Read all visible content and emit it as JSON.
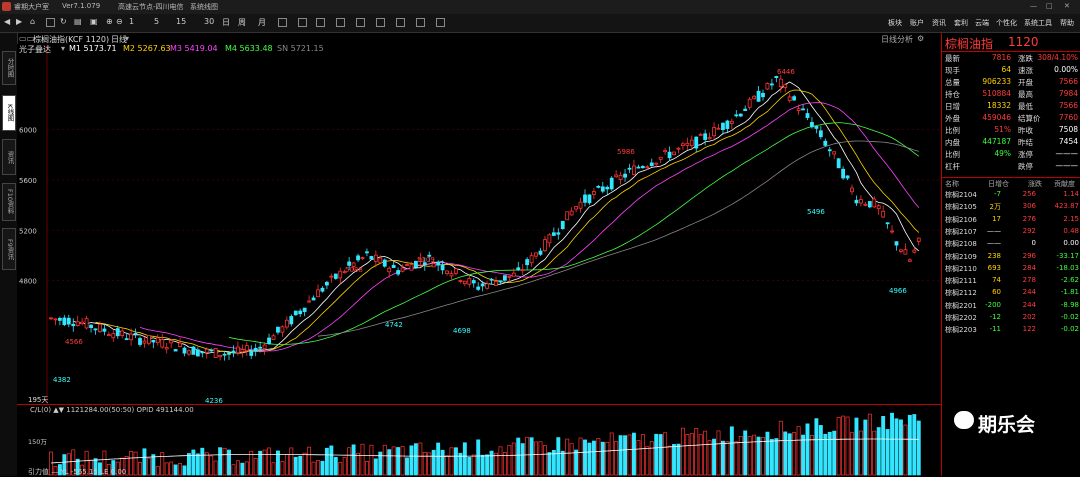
{
  "app": {
    "name": "睿期大户室",
    "version": "Ver7.1.079",
    "server": "高速云节点-四川电信",
    "window_label": "系统线图"
  },
  "toolbar": {
    "periods": [
      "1",
      "5",
      "15",
      "30",
      "日",
      "周",
      "月"
    ],
    "menus": [
      "板块",
      "账户",
      "资讯",
      "套利",
      "云端",
      "个性化",
      "系统工具",
      "帮助"
    ]
  },
  "left_tabs": [
    "分时图",
    "K线图",
    "资讯",
    "F10资料",
    "F9资讯"
  ],
  "chart": {
    "instrument": "棕榈油指(KCF 1120)",
    "period": "日线",
    "indicator_name": "光子叠达",
    "ma": [
      {
        "label": "M1 5173.71",
        "color": "#ffffff"
      },
      {
        "label": "M2 5267.63",
        "color": "#ffd400"
      },
      {
        "label": "M3 5419.04",
        "color": "#ff44ff"
      },
      {
        "label": "M4 5633.48",
        "color": "#44ff44"
      },
      {
        "label": "SN 5721.15",
        "color": "#888888"
      }
    ],
    "right_label": "日线分析",
    "y_ticks": [
      "6000",
      "5600",
      "5200",
      "4800"
    ],
    "price_labels": [
      "6446",
      "5986",
      "5496",
      "5088",
      "5109",
      "4742",
      "4698",
      "4566",
      "4382",
      "4236",
      "4966"
    ],
    "bottom_left": "195天",
    "sub_indicator": "C/L(0) ▲▼ 1121284.00(50:50) OPID 491144.00",
    "sub_tick": "150万",
    "sub_bottom": "引力值 — YL -565.15 LE 0.00"
  },
  "quote": {
    "title": "棕榈油指",
    "code": "1120",
    "rows": [
      {
        "l1": "最新",
        "v1": "7816",
        "l2": "涨跌",
        "v2": "308/4.10%"
      },
      {
        "l1": "现手",
        "v1": "64",
        "l2": "速涨",
        "v2": "0.00%"
      },
      {
        "l1": "总量",
        "v1": "906233",
        "l2": "开盘",
        "v2": "7566"
      },
      {
        "l1": "持仓",
        "v1": "510884",
        "l2": "最高",
        "v2": "7984"
      },
      {
        "l1": "日增",
        "v1": "18332",
        "l2": "最低",
        "v2": "7566"
      },
      {
        "l1": "外盘",
        "v1": "459046",
        "l2": "结算价",
        "v2": "7760"
      },
      {
        "l1": "比例",
        "v1": "51%",
        "l2": "昨收",
        "v2": "7508"
      },
      {
        "l1": "内盘",
        "v1": "447187",
        "l2": "昨结",
        "v2": "7454"
      },
      {
        "l1": "比例",
        "v1": "49%",
        "l2": "涨停",
        "v2": "———"
      },
      {
        "l1": "杠杆",
        "v1": "",
        "l2": "跌停",
        "v2": "———"
      }
    ],
    "contract_headers": [
      "名称",
      "日增仓",
      "涨跌",
      "贡献度"
    ],
    "contracts": [
      {
        "name": "棕榈2104",
        "inc": "-7",
        "chg": "256",
        "contrib": "1.14"
      },
      {
        "name": "棕榈2105",
        "inc": "2万",
        "chg": "306",
        "contrib": "423.87"
      },
      {
        "name": "棕榈2106",
        "inc": "17",
        "chg": "276",
        "contrib": "2.15"
      },
      {
        "name": "棕榈2107",
        "inc": "——",
        "chg": "292",
        "contrib": "0.48"
      },
      {
        "name": "棕榈2108",
        "inc": "——",
        "chg": "0",
        "contrib": "0.00"
      },
      {
        "name": "棕榈2109",
        "inc": "238",
        "chg": "296",
        "contrib": "-33.17"
      },
      {
        "name": "棕榈2110",
        "inc": "693",
        "chg": "284",
        "contrib": "-18.03"
      },
      {
        "name": "棕榈2111",
        "inc": "74",
        "chg": "278",
        "contrib": "-2.62"
      },
      {
        "name": "棕榈2112",
        "inc": "60",
        "chg": "244",
        "contrib": "-1.81"
      },
      {
        "name": "棕榈2201",
        "inc": "-200",
        "chg": "244",
        "contrib": "-8.98"
      },
      {
        "name": "棕榈2202",
        "inc": "-12",
        "chg": "202",
        "contrib": "-0.02"
      },
      {
        "name": "棕榈2203",
        "inc": "-11",
        "chg": "122",
        "contrib": "-0.02"
      }
    ]
  },
  "watermark": "期乐会"
}
